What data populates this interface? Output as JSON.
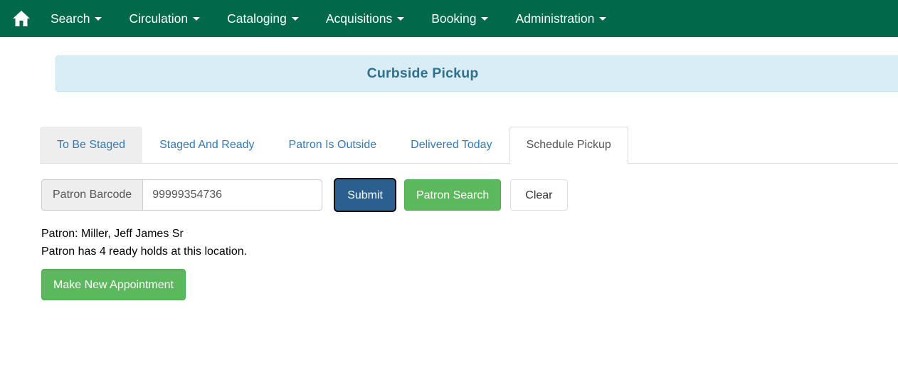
{
  "navbar": {
    "home_icon": "home-icon",
    "items": [
      {
        "label": "Search",
        "has_caret": true
      },
      {
        "label": "Circulation",
        "has_caret": true
      },
      {
        "label": "Cataloging",
        "has_caret": true
      },
      {
        "label": "Acquisitions",
        "has_caret": true
      },
      {
        "label": "Booking",
        "has_caret": true
      },
      {
        "label": "Administration",
        "has_caret": true
      }
    ],
    "background_color": "#00694a",
    "text_color": "#ffffff"
  },
  "banner": {
    "title": "Curbside Pickup",
    "background_color": "#d9edf7",
    "border_color": "#bce8f1",
    "text_color": "#31708f"
  },
  "tabs": [
    {
      "label": "To Be Staged",
      "state": "hovered"
    },
    {
      "label": "Staged And Ready",
      "state": "normal"
    },
    {
      "label": "Patron Is Outside",
      "state": "normal"
    },
    {
      "label": "Delivered Today",
      "state": "normal"
    },
    {
      "label": "Schedule Pickup",
      "state": "active"
    }
  ],
  "form": {
    "addon_label": "Patron Barcode",
    "barcode_value": "99999354736",
    "barcode_placeholder": "",
    "submit_label": "Submit",
    "patron_search_label": "Patron Search",
    "clear_label": "Clear",
    "submit_color": "#2a5f8f",
    "green_color": "#5cb85c"
  },
  "patron": {
    "name_line": "Patron: Miller, Jeff James Sr",
    "holds_line": "Patron has 4 ready holds at this location.",
    "appointment_button": "Make New Appointment"
  }
}
